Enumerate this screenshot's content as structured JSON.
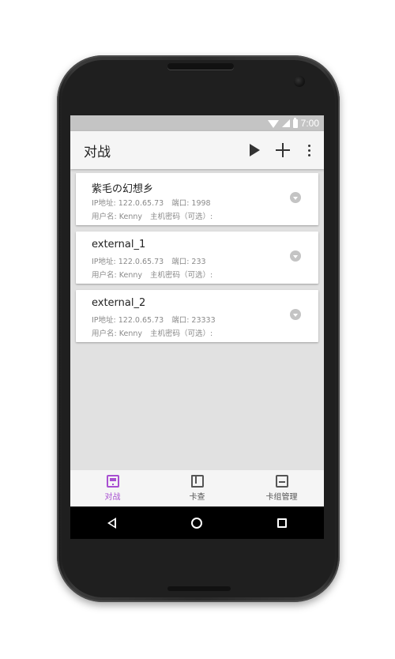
{
  "statusbar": {
    "time": "7:00"
  },
  "appbar": {
    "title": "对战",
    "icons": [
      "play-icon",
      "plus-icon",
      "more-vert-icon"
    ]
  },
  "servers": [
    {
      "name": "紫毛の幻想乡",
      "ip_label": "IP地址:",
      "ip": "122.0.65.73",
      "port_label": "端口:",
      "port": "1998",
      "user_label": "用户名:",
      "user": "Kenny",
      "password_label": "主机密码（可选）:"
    },
    {
      "name": "external_1",
      "ip_label": "IP地址:",
      "ip": "122.0.65.73",
      "port_label": "端口:",
      "port": "233",
      "user_label": "用户名:",
      "user": "Kenny",
      "password_label": "主机密码（可选）:"
    },
    {
      "name": "external_2",
      "ip_label": "IP地址:",
      "ip": "122.0.65.73",
      "port_label": "端口:",
      "port": "23333",
      "user_label": "用户名:",
      "user": "Kenny",
      "password_label": "主机密码（可选）:"
    }
  ],
  "bottomnav": [
    {
      "label": "对战",
      "active": true
    },
    {
      "label": "卡查",
      "active": false
    },
    {
      "label": "卡组管理",
      "active": false
    }
  ],
  "colors": {
    "accent": "#a84fd1",
    "statusbar": "#c4c4c4",
    "background": "#e1e1e1"
  }
}
